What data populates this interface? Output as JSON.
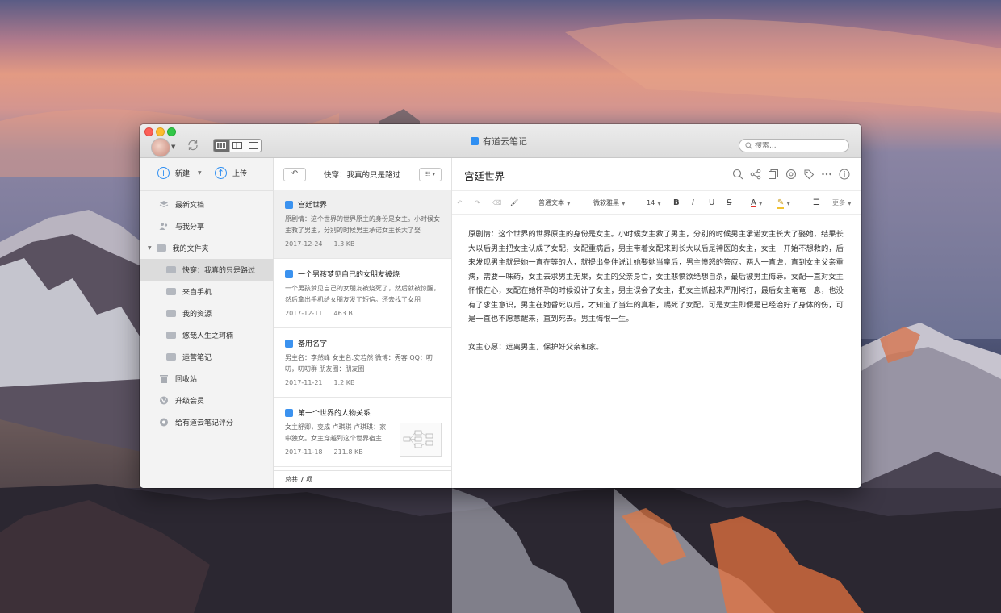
{
  "app": {
    "title": "有道云笔记"
  },
  "search": {
    "placeholder": "搜索..."
  },
  "sidebar": {
    "new_label": "新建",
    "upload_label": "上传",
    "items": [
      {
        "label": "最新文档",
        "icon": "latest-docs-icon"
      },
      {
        "label": "与我分享",
        "icon": "shared-icon"
      },
      {
        "label": "我的文件夹",
        "icon": "folder-icon"
      },
      {
        "label": "快穿：我真的只是路过",
        "icon": "folder-icon"
      },
      {
        "label": "来自手机",
        "icon": "folder-icon"
      },
      {
        "label": "我的资源",
        "icon": "folder-icon"
      },
      {
        "label": "悠哉人生之珂楠",
        "icon": "folder-icon"
      },
      {
        "label": "运营笔记",
        "icon": "folder-icon"
      },
      {
        "label": "回收站",
        "icon": "trash-icon"
      },
      {
        "label": "升级会员",
        "icon": "vip-icon"
      },
      {
        "label": "给有道云笔记评分",
        "icon": "rate-icon"
      }
    ]
  },
  "notes": {
    "folder_title": "快穿：我真的只是路过",
    "back_label": "↶",
    "total": "总共 7 项",
    "items": [
      {
        "title": "宫廷世界",
        "excerpt": "原剧情：这个世界的世界原主的身份是女主。小时候女主救了男主，分别的时候男主承诺女主长大了娶",
        "date": "2017-12-24",
        "size": "1.3 KB"
      },
      {
        "title": "一个男孩梦见自己的女朋友被烧",
        "excerpt": "一个男孩梦见自己的女朋友被烧死了，然后就被惊醒，然后拿出手机给女朋友发了短信。还去找了女朋",
        "date": "2017-12-11",
        "size": "463 B"
      },
      {
        "title": "备用名字",
        "excerpt": "男主名：李然峰 女主名:安若然 微博：秀客 QQ：叨叨，叨叨群 朋友圈：朋友圈",
        "date": "2017-11-21",
        "size": "1.2 KB"
      },
      {
        "title": "第一个世界的人物关系",
        "excerpt": "女主舒卿，变成 卢琪琪 卢琪琪：家中独女。女主穿越到这个世界宿主…",
        "date": "2017-11-18",
        "size": "211.8 KB"
      }
    ]
  },
  "editor": {
    "title": "宫廷世界",
    "toolbar": {
      "paragraph_style": "普通文本",
      "font": "微软雅黑",
      "font_size": "14",
      "bold": "B",
      "italic": "I",
      "underline": "U",
      "strike": "S",
      "font_color_label": "A",
      "more": "更多"
    },
    "paragraphs": [
      "原剧情：这个世界的世界原主的身份是女主。小时候女主救了男主，分别的时候男主承诺女主长大了娶她，结果长大以后男主把女主认成了女配，女配重病后，男主带着女配来到长大以后是神医的女主，女主一开始不想救的，后来发现男主就是她一直在等的人，就提出条件说让她娶她当皇后，男主愤怒的答应。两人一直虐，直到女主父亲重病，需要一味药，女主去求男主无果，女主的父亲身亡，女主悲愤欲绝想自杀，最后被男主侮辱。女配一直对女主怀恨在心，女配在她怀孕的时候设计了女主，男主误会了女主，把女主抓起来严刑拷打，最后女主奄奄一息，也没有了求生意识，男主在她昏死以后，才知道了当年的真相，赐死了女配。可是女主即便是已经治好了身体的伤，可是一直也不愿意醒来，直到死去。男主悔恨一生。",
      "女主心愿：远离男主，保护好父亲和家。"
    ]
  },
  "colors": {
    "accent": "#2f8ff2",
    "font_color": "#e0322b",
    "highlight": "#f2c230"
  }
}
